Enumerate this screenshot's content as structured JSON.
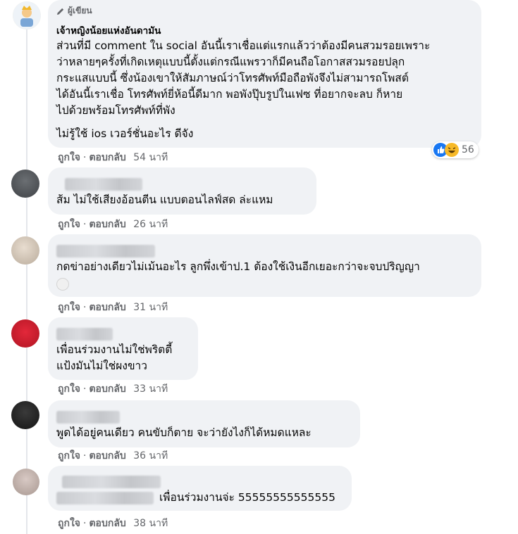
{
  "comments": [
    {
      "author_badge": "ผู้เขียน",
      "author_name": "เจ้าหญิงน้อยแห่งอันดามัน",
      "lines": [
        "ส่วนที่มี comment ใน social อันนี้เราเชื่อแต่แรกแล้วว่าต้องมีคนสวมรอยเพราะ",
        "ว่าหลายๆครั้งที่เกิดเหตุแบบนี้ตั้งแต่กรณีแพรวาก็มีคนถือโอกาสสวมรอยปลุก",
        "กระแสแบบนี้ ซึ่งน้องเขาให้สัมภาษณ์ว่าโทรศัพท์มือถือพังจึงไม่สามารถโพสต์",
        "ได้อันนี้เราเชื่อ โทรศัพท์ยี่ห้อนี้ดีมาก พอพังปุ๊บรูปในเฟซ ที่อยากจะลบ ก็หาย",
        "ไปด้วยพร้อมโทรศัพท์ที่พัง",
        "",
        "ไม่รู้ใช้ ios เวอร์ชั่นอะไร ดีจัง"
      ],
      "like_label": "ถูกใจ",
      "reply_label": "ตอบกลับ",
      "time": "54 นาที",
      "reaction_count": "56"
    },
    {
      "text": "ส้ม ไม่ใช้เสียงอ้อนตีน แบบตอนไลฟ์สด ล่ะแหม",
      "like_label": "ถูกใจ",
      "reply_label": "ตอบกลับ",
      "time": "26 นาที"
    },
    {
      "text": "กดข่าอย่างเดียวไม่เม้นอะไร ลูกพึ่งเข้าป.1 ต้องใช้เงินอีกเยอะกว่าจะจบปริญญา",
      "like_label": "ถูกใจ",
      "reply_label": "ตอบกลับ",
      "time": "31 นาที"
    },
    {
      "lines": [
        "เพื่อนร่วมงานไม่ใช่พริตตี้",
        "แป้งมันไม่ใช่ผงขาว"
      ],
      "like_label": "ถูกใจ",
      "reply_label": "ตอบกลับ",
      "time": "33 นาที"
    },
    {
      "text": "พูดได้อยู่คนเดียว คนขับก็ตาย จะว่ายังไงก็ได้หมดแหละ",
      "like_label": "ถูกใจ",
      "reply_label": "ตอบกลับ",
      "time": "36 นาที"
    },
    {
      "text": "เพื่อนร่วมงานจ่ะ 55555555555555",
      "like_label": "ถูกใจ",
      "reply_label": "ตอบกลับ",
      "time": "38 นาที"
    }
  ],
  "separator": "·",
  "colors": {
    "bubble": "#f0f2f5",
    "meta_text": "#65676b",
    "like_blue": "#1877f2",
    "haha_yellow": "#f7b928"
  }
}
